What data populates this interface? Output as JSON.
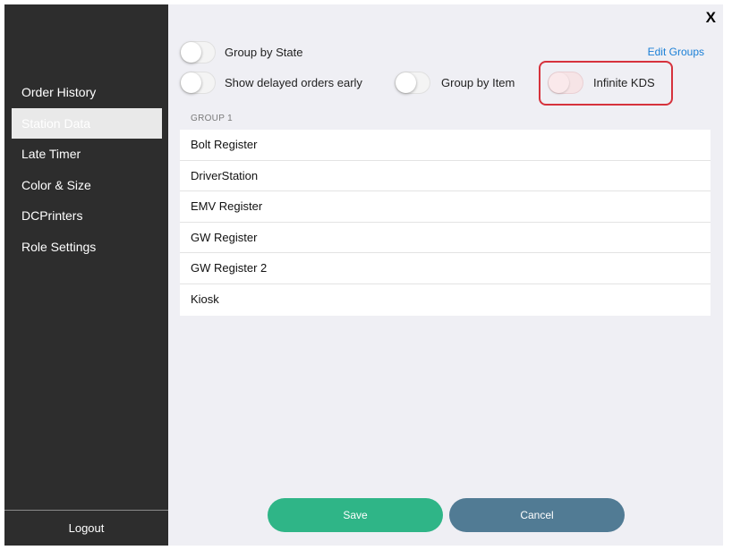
{
  "sidebar": {
    "items": [
      {
        "label": "Order History"
      },
      {
        "label": "Station Data",
        "active": true
      },
      {
        "label": "Late Timer"
      },
      {
        "label": "Color & Size"
      },
      {
        "label": "DCPrinters"
      },
      {
        "label": "Role Settings"
      }
    ],
    "logout_label": "Logout"
  },
  "header": {
    "close_label": "X",
    "edit_groups_label": "Edit Groups"
  },
  "toggles": {
    "group_by_state": {
      "label": "Group by State",
      "on": false
    },
    "show_delayed": {
      "label": "Show delayed orders early",
      "on": false
    },
    "group_by_item": {
      "label": "Group by Item",
      "on": false
    },
    "infinite_kds": {
      "label": "Infinite KDS",
      "on": false
    }
  },
  "group": {
    "header": "GROUP 1",
    "stations": [
      "Bolt Register",
      "DriverStation",
      "EMV Register",
      "GW Register",
      "GW Register 2",
      "Kiosk"
    ]
  },
  "actions": {
    "save_label": "Save",
    "cancel_label": "Cancel"
  },
  "colors": {
    "sidebar_bg": "#2d2d2d",
    "main_bg": "#efeff4",
    "link": "#1a7fd6",
    "save": "#2fb587",
    "cancel": "#517b94",
    "highlight": "#d6323c"
  }
}
